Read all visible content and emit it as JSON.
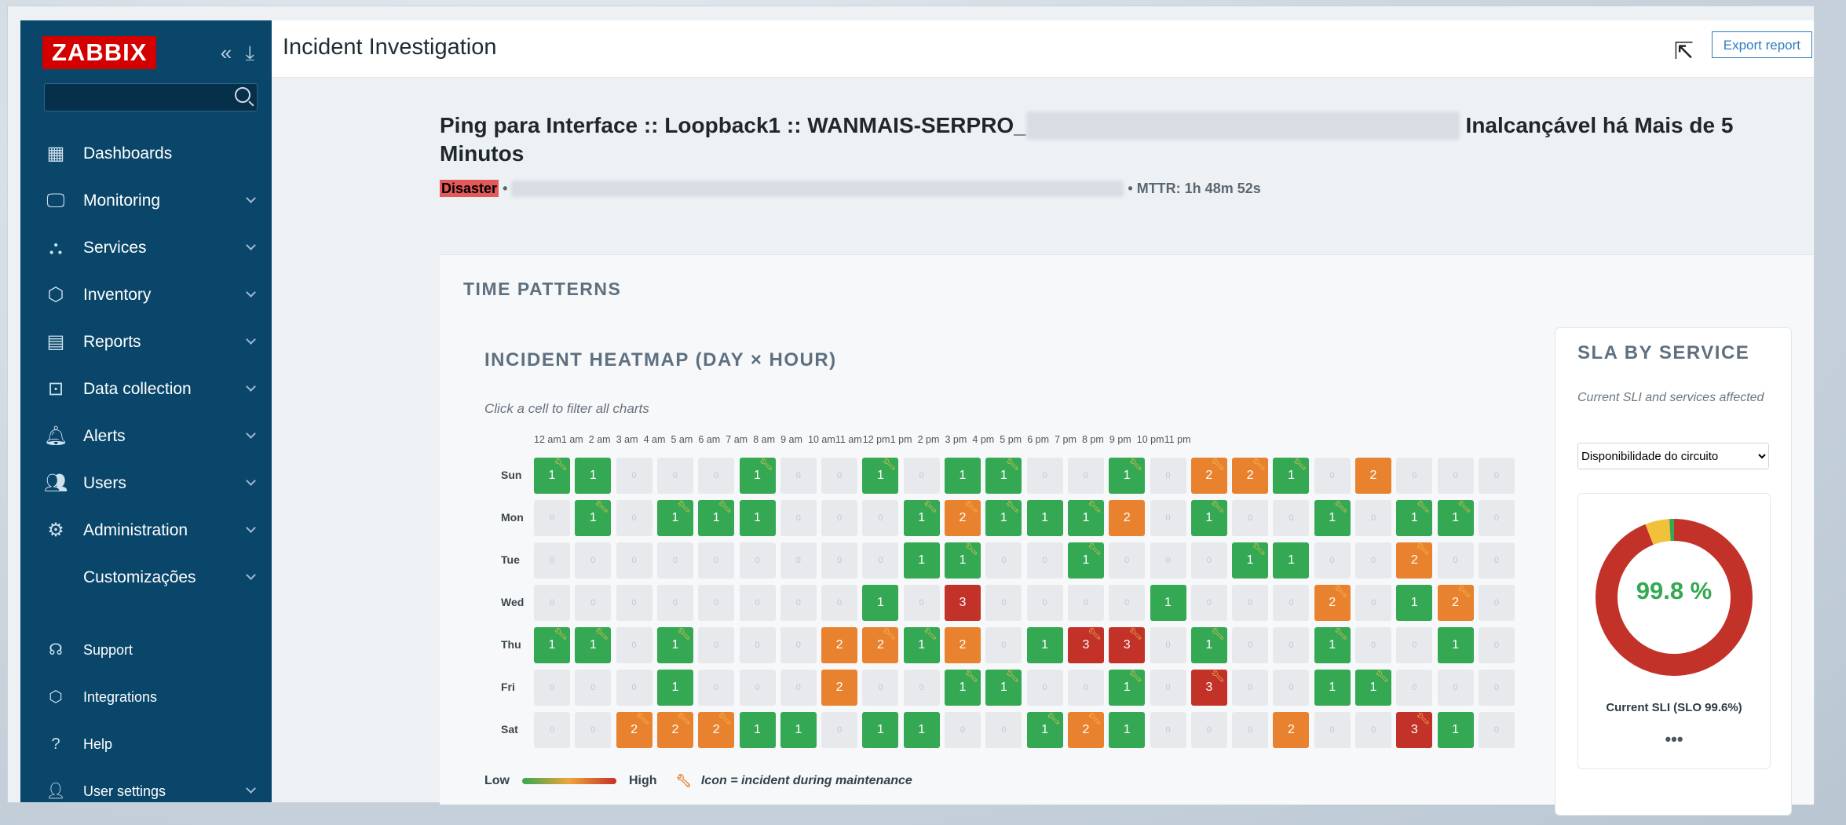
{
  "sidebar": {
    "logo": "ZABBIX",
    "collapse_icon": "«",
    "kiosk_icon": "⤓",
    "search_placeholder": "",
    "items": [
      {
        "label": "Dashboards",
        "icon": "dashboard-icon"
      },
      {
        "label": "Monitoring",
        "icon": "monitoring-icon"
      },
      {
        "label": "Services",
        "icon": "services-icon"
      },
      {
        "label": "Inventory",
        "icon": "inventory-icon"
      },
      {
        "label": "Reports",
        "icon": "reports-icon"
      },
      {
        "label": "Data collection",
        "icon": "data-collection-icon"
      },
      {
        "label": "Alerts",
        "icon": "bell-icon"
      },
      {
        "label": "Users",
        "icon": "users-icon"
      },
      {
        "label": "Administration",
        "icon": "gear-icon"
      },
      {
        "label": "Customizações",
        "icon": ""
      }
    ],
    "bottom_items": [
      {
        "label": "Support",
        "icon": "support-icon"
      },
      {
        "label": "Integrations",
        "icon": "integrations-icon"
      },
      {
        "label": "Help",
        "icon": "help-icon"
      },
      {
        "label": "User settings",
        "icon": "user-icon"
      }
    ]
  },
  "header": {
    "title": "Incident Investigation",
    "export_label": "Export report"
  },
  "incident": {
    "title_prefix": "Ping para Interface :: Loopback1 :: WANMAIS-SERPRO_",
    "title_suffix": " Inalcançável há Mais de 5 Minutos",
    "severity": "Disaster",
    "mttr": "• MTTR: 1h 48m 52s"
  },
  "time_patterns": {
    "section_title": "TIME PATTERNS",
    "heatmap_title": "INCIDENT HEATMAP (DAY × HOUR)",
    "hint": "Click a cell to filter all charts",
    "legend_low": "Low",
    "legend_high": "High",
    "legend_icon_text": "Icon = incident during maintenance",
    "hours": [
      "12 am",
      "1 am",
      "2 am",
      "3 am",
      "4 am",
      "5 am",
      "6 am",
      "7 am",
      "8 am",
      "9 am",
      "10 am",
      "11 am",
      "12 pm",
      "1 pm",
      "2 pm",
      "3 pm",
      "4 pm",
      "5 pm",
      "6 pm",
      "7 pm",
      "8 pm",
      "9 pm",
      "10 pm",
      "11 pm"
    ],
    "days": [
      "Sun",
      "Mon",
      "Tue",
      "Wed",
      "Thu",
      "Fri",
      "Sat"
    ],
    "zero_label": "0",
    "grid_values": [
      [
        1,
        1,
        0,
        0,
        0,
        1,
        0,
        0,
        1,
        0,
        1,
        1,
        0,
        0,
        1,
        0,
        2,
        2,
        1,
        0,
        2,
        0,
        0,
        0
      ],
      [
        0,
        1,
        0,
        1,
        1,
        1,
        0,
        0,
        0,
        1,
        2,
        1,
        1,
        1,
        2,
        0,
        1,
        0,
        0,
        1,
        0,
        1,
        1,
        0
      ],
      [
        0,
        0,
        0,
        0,
        0,
        0,
        0,
        0,
        0,
        1,
        1,
        0,
        0,
        1,
        0,
        0,
        0,
        1,
        1,
        0,
        0,
        2,
        0,
        0
      ],
      [
        0,
        0,
        0,
        0,
        0,
        0,
        0,
        0,
        1,
        0,
        3,
        0,
        0,
        0,
        0,
        1,
        0,
        0,
        0,
        2,
        0,
        1,
        2,
        0
      ],
      [
        1,
        1,
        0,
        1,
        0,
        0,
        0,
        2,
        2,
        1,
        2,
        0,
        1,
        3,
        3,
        0,
        1,
        0,
        0,
        1,
        0,
        0,
        1,
        0
      ],
      [
        0,
        0,
        0,
        1,
        0,
        0,
        0,
        2,
        0,
        0,
        1,
        1,
        0,
        0,
        1,
        0,
        3,
        0,
        0,
        1,
        1,
        0,
        0,
        0
      ],
      [
        0,
        0,
        2,
        2,
        2,
        1,
        1,
        0,
        1,
        1,
        0,
        0,
        1,
        2,
        1,
        0,
        0,
        0,
        2,
        0,
        0,
        3,
        1,
        0
      ]
    ],
    "maintenance_flags": [
      [
        1,
        0,
        0,
        0,
        0,
        1,
        0,
        0,
        1,
        0,
        0,
        1,
        0,
        0,
        1,
        0,
        1,
        1,
        1,
        0,
        0,
        0,
        0,
        0
      ],
      [
        0,
        1,
        0,
        1,
        1,
        0,
        0,
        0,
        0,
        1,
        1,
        1,
        0,
        1,
        0,
        0,
        1,
        0,
        0,
        1,
        0,
        1,
        1,
        0
      ],
      [
        0,
        0,
        0,
        0,
        0,
        0,
        0,
        0,
        0,
        0,
        1,
        0,
        0,
        1,
        0,
        0,
        0,
        1,
        0,
        0,
        0,
        1,
        0,
        0
      ],
      [
        0,
        0,
        0,
        0,
        0,
        0,
        0,
        0,
        0,
        0,
        0,
        0,
        0,
        0,
        0,
        0,
        0,
        0,
        0,
        1,
        0,
        0,
        1,
        0
      ],
      [
        1,
        1,
        0,
        1,
        0,
        0,
        0,
        0,
        1,
        1,
        0,
        0,
        0,
        1,
        1,
        0,
        1,
        0,
        0,
        1,
        0,
        0,
        0,
        0
      ],
      [
        0,
        0,
        0,
        0,
        0,
        0,
        0,
        0,
        0,
        0,
        1,
        1,
        0,
        0,
        1,
        0,
        1,
        0,
        0,
        0,
        1,
        0,
        0,
        0
      ],
      [
        0,
        0,
        1,
        1,
        1,
        0,
        0,
        0,
        0,
        0,
        0,
        0,
        1,
        1,
        0,
        0,
        0,
        0,
        0,
        0,
        0,
        1,
        0,
        0
      ]
    ]
  },
  "sla": {
    "title": "SLA BY SERVICE",
    "subtitle": "Current SLI and services affected",
    "selected_service": "Disponibilidade do circuito",
    "value": "99.8 %",
    "label": "Current SLI (SLO 99.6%)",
    "more": "•••",
    "donut_fractions": [
      0.94,
      0.05,
      0.01
    ],
    "colors": [
      "#c23229",
      "#f2c13a",
      "#34a853"
    ]
  },
  "colors": {
    "sidebar_bg": "#0a466a",
    "green": "#34a853",
    "orange": "#e9822f",
    "red": "#c23229",
    "empty": "#e7e9ec"
  }
}
